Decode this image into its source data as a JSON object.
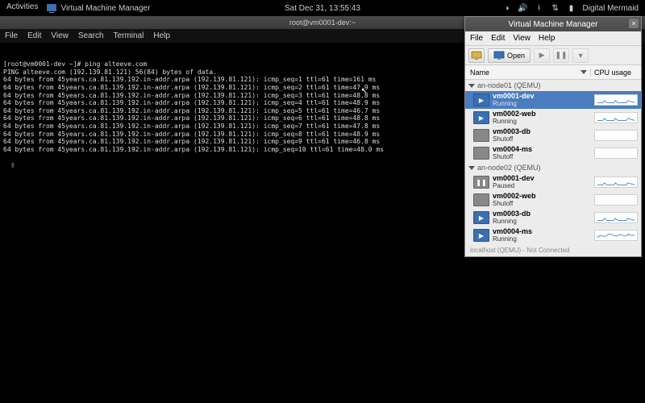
{
  "topbar": {
    "activities": "Activities",
    "app_name": "Virtual Machine Manager",
    "clock": "Sat Dec 31, 13:55:43",
    "user": "Digital Mermaid"
  },
  "terminal": {
    "title": "root@vm0001-dev:~",
    "menu": {
      "file": "File",
      "edit": "Edit",
      "view": "View",
      "search": "Search",
      "terminal": "Terminal",
      "help": "Help"
    },
    "lines": [
      "[root@vm0001-dev ~]# ping alteeve.com",
      "PING alteeve.com (192.139.81.121) 56(84) bytes of data.",
      "64 bytes from 45years.ca.81.139.192.in-addr.arpa (192.139.81.121): icmp_seq=1 ttl=61 time=161 ms",
      "64 bytes from 45years.ca.81.139.192.in-addr.arpa (192.139.81.121): icmp_seq=2 ttl=61 time=47.9 ms",
      "64 bytes from 45years.ca.81.139.192.in-addr.arpa (192.139.81.121): icmp_seq=3 ttl=61 time=48.8 ms",
      "64 bytes from 45years.ca.81.139.192.in-addr.arpa (192.139.81.121): icmp_seq=4 ttl=61 time=48.9 ms",
      "64 bytes from 45years.ca.81.139.192.in-addr.arpa (192.139.81.121): icmp_seq=5 ttl=61 time=46.7 ms",
      "64 bytes from 45years.ca.81.139.192.in-addr.arpa (192.139.81.121): icmp_seq=6 ttl=61 time=48.8 ms",
      "64 bytes from 45years.ca.81.139.192.in-addr.arpa (192.139.81.121): icmp_seq=7 ttl=61 time=47.8 ms",
      "64 bytes from 45years.ca.81.139.192.in-addr.arpa (192.139.81.121): icmp_seq=8 ttl=61 time=48.9 ms",
      "64 bytes from 45years.ca.81.139.192.in-addr.arpa (192.139.81.121): icmp_seq=9 ttl=61 time=46.8 ms",
      "64 bytes from 45years.ca.81.139.192.in-addr.arpa (192.139.81.121): icmp_seq=10 ttl=61 time=48.0 ms"
    ]
  },
  "vmm": {
    "title": "Virtual Machine Manager",
    "menu": {
      "file": "File",
      "edit": "Edit",
      "view": "View",
      "help": "Help"
    },
    "toolbar": {
      "open": "Open"
    },
    "columns": {
      "name": "Name",
      "cpu": "CPU usage"
    },
    "groups": [
      {
        "label": "an-node01 (QEMU)",
        "vms": [
          {
            "name": "vm0001-dev",
            "state": "Running",
            "selected": true,
            "running": true
          },
          {
            "name": "vm0002-web",
            "state": "Running",
            "selected": false,
            "running": true
          },
          {
            "name": "vm0003-db",
            "state": "Shutoff",
            "selected": false,
            "running": false
          },
          {
            "name": "vm0004-ms",
            "state": "Shutoff",
            "selected": false,
            "running": false
          }
        ]
      },
      {
        "label": "an-node02 (QEMU)",
        "vms": [
          {
            "name": "vm0001-dev",
            "state": "Paused",
            "selected": false,
            "running": false
          },
          {
            "name": "vm0002-web",
            "state": "Shutoff",
            "selected": false,
            "running": false
          },
          {
            "name": "vm0003-db",
            "state": "Running",
            "selected": false,
            "running": true
          },
          {
            "name": "vm0004-ms",
            "state": "Running",
            "selected": false,
            "running": true
          }
        ]
      }
    ],
    "disconnected": "localhost (QEMU) - Not Connected"
  }
}
